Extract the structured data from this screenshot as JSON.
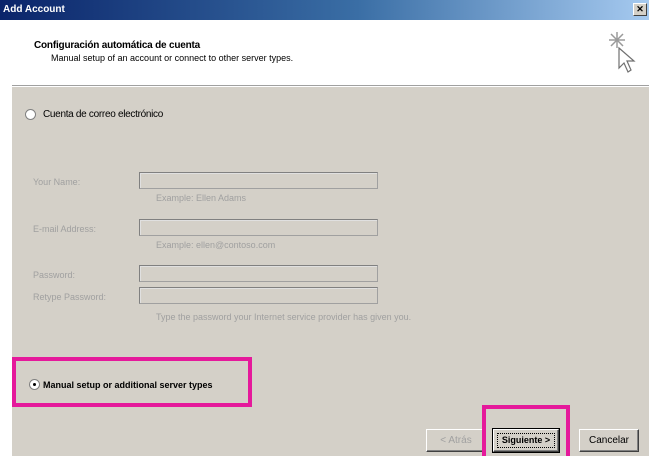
{
  "window": {
    "title": "Add Account",
    "close_glyph": "✕"
  },
  "header": {
    "title": "Configuración automática de cuenta",
    "subtitle": "Manual setup of an account or connect to other server types.",
    "icon": "wizard-cursor-sparkle-icon"
  },
  "email_option": {
    "label": "Cuenta de correo electrónico",
    "selected": false
  },
  "form": {
    "your_name": {
      "label": "Your Name:",
      "value": "",
      "example": "Example: Ellen Adams"
    },
    "email": {
      "label": "E-mail Address:",
      "value": "",
      "example": "Example: ellen@contoso.com"
    },
    "password": {
      "label": "Password:",
      "value": ""
    },
    "retype_password": {
      "label": "Retype Password:",
      "value": ""
    },
    "password_hint": "Type the password your Internet service provider has given you."
  },
  "manual_option": {
    "label": "Manual setup or additional server types",
    "selected": true
  },
  "buttons": {
    "back": "< Atrás",
    "next": "Siguiente >",
    "cancel": "Cancelar"
  },
  "colors": {
    "highlight": "#e5199b",
    "titlebar": "#0a246a",
    "dialog": "#d4d0c8"
  }
}
